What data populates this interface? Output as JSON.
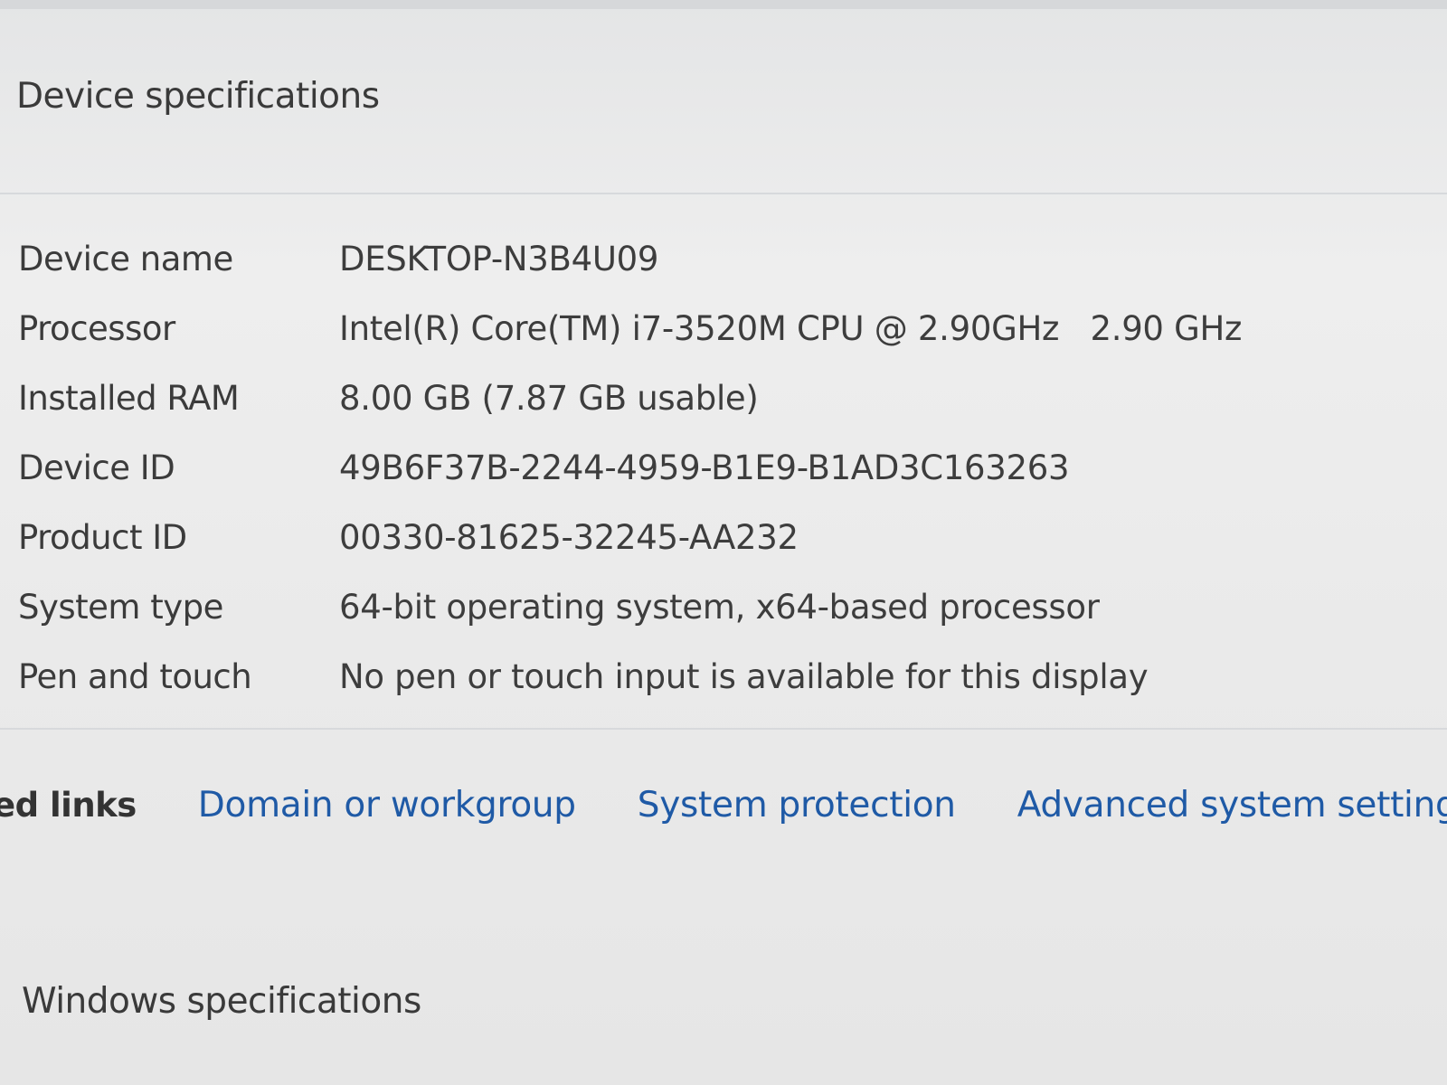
{
  "device_specifications": {
    "heading": "Device specifications",
    "rows": [
      {
        "label": "Device name",
        "value": "DESKTOP-N3B4U09"
      },
      {
        "label": "Processor",
        "value": "Intel(R) Core(TM) i7-3520M CPU @ 2.90GHz   2.90 GHz"
      },
      {
        "label": "Installed RAM",
        "value": "8.00 GB (7.87 GB usable)"
      },
      {
        "label": "Device ID",
        "value": "49B6F37B-2244-4959-B1E9-B1AD3C163263"
      },
      {
        "label": "Product ID",
        "value": "00330-81625-32245-AA232"
      },
      {
        "label": "System type",
        "value": "64-bit operating system, x64-based processor"
      },
      {
        "label": "Pen and touch",
        "value": "No pen or touch input is available for this display"
      }
    ]
  },
  "related_links": {
    "label": "ed links",
    "links": [
      "Domain or workgroup",
      "System protection",
      "Advanced system settings"
    ]
  },
  "windows_specifications": {
    "heading": "Windows specifications"
  },
  "colors": {
    "link": "#1f5aa6",
    "text": "#3b3b3b",
    "background": "#ececec"
  }
}
